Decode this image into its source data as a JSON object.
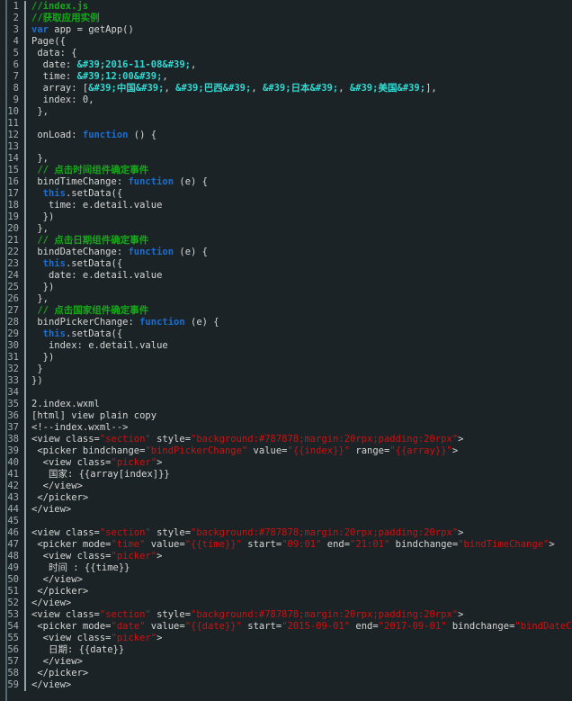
{
  "editor": {
    "background": "#1c2326",
    "gutter_color": "#9fb0b5",
    "default_text_color": "#d6d6d6",
    "comment_color": "#17a81a",
    "keyword_color": "#1a6fd4",
    "string_color": "#2fd9d2",
    "attribute_value_color": "#cc1111",
    "total_lines": 59
  },
  "lines": [
    {
      "n": "1",
      "tokens": [
        {
          "t": "comment",
          "s": "//index.js"
        }
      ]
    },
    {
      "n": "2",
      "tokens": [
        {
          "t": "comment",
          "s": "//获取应用实例"
        }
      ]
    },
    {
      "n": "3",
      "tokens": [
        {
          "t": "keyword",
          "s": "var"
        },
        {
          "t": "plain",
          "s": " app = getApp()"
        }
      ]
    },
    {
      "n": "4",
      "tokens": [
        {
          "t": "plain",
          "s": "Page({"
        }
      ]
    },
    {
      "n": "5",
      "tokens": [
        {
          "t": "plain",
          "s": " data: {"
        }
      ]
    },
    {
      "n": "6",
      "tokens": [
        {
          "t": "plain",
          "s": "  date: "
        },
        {
          "t": "string",
          "s": "&#39;2016-11-08&#39;"
        },
        {
          "t": "plain",
          "s": ","
        }
      ]
    },
    {
      "n": "7",
      "tokens": [
        {
          "t": "plain",
          "s": "  time: "
        },
        {
          "t": "string",
          "s": "&#39;12:00&#39;"
        },
        {
          "t": "plain",
          "s": ","
        }
      ]
    },
    {
      "n": "8",
      "tokens": [
        {
          "t": "plain",
          "s": "  array: ["
        },
        {
          "t": "string",
          "s": "&#39;中国&#39;"
        },
        {
          "t": "plain",
          "s": ", "
        },
        {
          "t": "string",
          "s": "&#39;巴西&#39;"
        },
        {
          "t": "plain",
          "s": ", "
        },
        {
          "t": "string",
          "s": "&#39;日本&#39;"
        },
        {
          "t": "plain",
          "s": ", "
        },
        {
          "t": "string",
          "s": "&#39;美国&#39;"
        },
        {
          "t": "plain",
          "s": "],"
        }
      ]
    },
    {
      "n": "9",
      "tokens": [
        {
          "t": "plain",
          "s": "  index: 0,"
        }
      ]
    },
    {
      "n": "10",
      "tokens": [
        {
          "t": "plain",
          "s": " },"
        }
      ]
    },
    {
      "n": "11",
      "tokens": []
    },
    {
      "n": "12",
      "tokens": [
        {
          "t": "plain",
          "s": " onLoad: "
        },
        {
          "t": "keyword",
          "s": "function"
        },
        {
          "t": "plain",
          "s": " () {"
        }
      ]
    },
    {
      "n": "13",
      "tokens": []
    },
    {
      "n": "14",
      "tokens": [
        {
          "t": "plain",
          "s": " },"
        }
      ]
    },
    {
      "n": "15",
      "tokens": [
        {
          "t": "plain",
          "s": " "
        },
        {
          "t": "comment",
          "s": "// 点击时间组件确定事件"
        }
      ]
    },
    {
      "n": "16",
      "tokens": [
        {
          "t": "plain",
          "s": " bindTimeChange: "
        },
        {
          "t": "keyword",
          "s": "function"
        },
        {
          "t": "plain",
          "s": " (e) {"
        }
      ]
    },
    {
      "n": "17",
      "tokens": [
        {
          "t": "plain",
          "s": "  "
        },
        {
          "t": "keyword",
          "s": "this"
        },
        {
          "t": "plain",
          "s": ".setData({"
        }
      ]
    },
    {
      "n": "18",
      "tokens": [
        {
          "t": "plain",
          "s": "   time: e.detail.value"
        }
      ]
    },
    {
      "n": "19",
      "tokens": [
        {
          "t": "plain",
          "s": "  })"
        }
      ]
    },
    {
      "n": "20",
      "tokens": [
        {
          "t": "plain",
          "s": " },"
        }
      ]
    },
    {
      "n": "21",
      "tokens": [
        {
          "t": "plain",
          "s": " "
        },
        {
          "t": "comment",
          "s": "// 点击日期组件确定事件"
        }
      ]
    },
    {
      "n": "22",
      "tokens": [
        {
          "t": "plain",
          "s": " bindDateChange: "
        },
        {
          "t": "keyword",
          "s": "function"
        },
        {
          "t": "plain",
          "s": " (e) {"
        }
      ]
    },
    {
      "n": "23",
      "tokens": [
        {
          "t": "plain",
          "s": "  "
        },
        {
          "t": "keyword",
          "s": "this"
        },
        {
          "t": "plain",
          "s": ".setData({"
        }
      ]
    },
    {
      "n": "24",
      "tokens": [
        {
          "t": "plain",
          "s": "   date: e.detail.value"
        }
      ]
    },
    {
      "n": "25",
      "tokens": [
        {
          "t": "plain",
          "s": "  })"
        }
      ]
    },
    {
      "n": "26",
      "tokens": [
        {
          "t": "plain",
          "s": " },"
        }
      ]
    },
    {
      "n": "27",
      "tokens": [
        {
          "t": "plain",
          "s": " "
        },
        {
          "t": "comment",
          "s": "// 点击国家组件确定事件"
        }
      ]
    },
    {
      "n": "28",
      "tokens": [
        {
          "t": "plain",
          "s": " bindPickerChange: "
        },
        {
          "t": "keyword",
          "s": "function"
        },
        {
          "t": "plain",
          "s": " (e) {"
        }
      ]
    },
    {
      "n": "29",
      "tokens": [
        {
          "t": "plain",
          "s": "  "
        },
        {
          "t": "keyword",
          "s": "this"
        },
        {
          "t": "plain",
          "s": ".setData({"
        }
      ]
    },
    {
      "n": "30",
      "tokens": [
        {
          "t": "plain",
          "s": "   index: e.detail.value"
        }
      ]
    },
    {
      "n": "31",
      "tokens": [
        {
          "t": "plain",
          "s": "  })"
        }
      ]
    },
    {
      "n": "32",
      "tokens": [
        {
          "t": "plain",
          "s": " }"
        }
      ]
    },
    {
      "n": "33",
      "tokens": [
        {
          "t": "plain",
          "s": "})"
        }
      ]
    },
    {
      "n": "34",
      "tokens": []
    },
    {
      "n": "35",
      "tokens": [
        {
          "t": "plain",
          "s": "2.index.wxml"
        }
      ]
    },
    {
      "n": "36",
      "tokens": [
        {
          "t": "plain",
          "s": "[html] view plain copy"
        }
      ]
    },
    {
      "n": "37",
      "tokens": [
        {
          "t": "plain",
          "s": "<!--index.wxml-->"
        }
      ]
    },
    {
      "n": "38",
      "tokens": [
        {
          "t": "tag",
          "s": "<view class="
        },
        {
          "t": "attrval",
          "s": "\"section\""
        },
        {
          "t": "tag",
          "s": " style="
        },
        {
          "t": "attrval",
          "s": "\"background:#787878;margin:20rpx;padding:20rpx\""
        },
        {
          "t": "tag",
          "s": ">"
        }
      ]
    },
    {
      "n": "39",
      "tokens": [
        {
          "t": "tag",
          "s": " <picker bindchange="
        },
        {
          "t": "attrval",
          "s": "\"bindPickerChange\""
        },
        {
          "t": "tag",
          "s": " value="
        },
        {
          "t": "attrval",
          "s": "\"{{index}}\""
        },
        {
          "t": "tag",
          "s": " range="
        },
        {
          "t": "attrval",
          "s": "\"{{array}}\""
        },
        {
          "t": "tag",
          "s": ">"
        }
      ]
    },
    {
      "n": "40",
      "tokens": [
        {
          "t": "tag",
          "s": "  <view class="
        },
        {
          "t": "attrval",
          "s": "\"picker\""
        },
        {
          "t": "tag",
          "s": ">"
        }
      ]
    },
    {
      "n": "41",
      "tokens": [
        {
          "t": "plain",
          "s": "   国家: {{array[index]}}"
        }
      ]
    },
    {
      "n": "42",
      "tokens": [
        {
          "t": "tag",
          "s": "  </view>"
        }
      ]
    },
    {
      "n": "43",
      "tokens": [
        {
          "t": "tag",
          "s": " </picker>"
        }
      ]
    },
    {
      "n": "44",
      "tokens": [
        {
          "t": "tag",
          "s": "</view>"
        }
      ]
    },
    {
      "n": "45",
      "tokens": []
    },
    {
      "n": "46",
      "tokens": [
        {
          "t": "tag",
          "s": "<view class="
        },
        {
          "t": "attrval",
          "s": "\"section\""
        },
        {
          "t": "tag",
          "s": " style="
        },
        {
          "t": "attrval",
          "s": "\"background:#787878;margin:20rpx;padding:20rpx\""
        },
        {
          "t": "tag",
          "s": ">"
        }
      ]
    },
    {
      "n": "47",
      "tokens": [
        {
          "t": "tag",
          "s": " <picker mode="
        },
        {
          "t": "attrval",
          "s": "\"time\""
        },
        {
          "t": "tag",
          "s": " value="
        },
        {
          "t": "attrval",
          "s": "\"{{time}}\""
        },
        {
          "t": "tag",
          "s": " start="
        },
        {
          "t": "attrval",
          "s": "\"09:01\""
        },
        {
          "t": "tag",
          "s": " end="
        },
        {
          "t": "attrval",
          "s": "\"21:01\""
        },
        {
          "t": "tag",
          "s": " bindchange="
        },
        {
          "t": "attrval",
          "s": "\"bindTimeChange\""
        },
        {
          "t": "tag",
          "s": ">"
        }
      ]
    },
    {
      "n": "48",
      "tokens": [
        {
          "t": "tag",
          "s": "  <view class="
        },
        {
          "t": "attrval",
          "s": "\"picker\""
        },
        {
          "t": "tag",
          "s": ">"
        }
      ]
    },
    {
      "n": "49",
      "tokens": [
        {
          "t": "plain",
          "s": "   时间 : {{time}}"
        }
      ]
    },
    {
      "n": "50",
      "tokens": [
        {
          "t": "tag",
          "s": "  </view>"
        }
      ]
    },
    {
      "n": "51",
      "tokens": [
        {
          "t": "tag",
          "s": " </picker>"
        }
      ]
    },
    {
      "n": "52",
      "tokens": [
        {
          "t": "tag",
          "s": "</view>"
        }
      ]
    },
    {
      "n": "53",
      "tokens": [
        {
          "t": "tag",
          "s": "<view class="
        },
        {
          "t": "attrval",
          "s": "\"section\""
        },
        {
          "t": "tag",
          "s": " style="
        },
        {
          "t": "attrval",
          "s": "\"background:#787878;margin:20rpx;padding:20rpx\""
        },
        {
          "t": "tag",
          "s": ">"
        }
      ]
    },
    {
      "n": "54",
      "tokens": [
        {
          "t": "tag",
          "s": " <picker mode="
        },
        {
          "t": "attrval",
          "s": "\"date\""
        },
        {
          "t": "tag",
          "s": " value="
        },
        {
          "t": "attrval",
          "s": "\"{{date}}\""
        },
        {
          "t": "tag",
          "s": " start="
        },
        {
          "t": "attrval",
          "s": "\"2015-09-01\""
        },
        {
          "t": "tag",
          "s": " end="
        },
        {
          "t": "attrval",
          "s": "\"2017-09-01\""
        },
        {
          "t": "tag",
          "s": " bindchange="
        },
        {
          "t": "attrval",
          "s": "\"bindDateChange\""
        },
        {
          "t": "tag",
          "s": ">"
        }
      ]
    },
    {
      "n": "55",
      "tokens": [
        {
          "t": "tag",
          "s": "  <view class="
        },
        {
          "t": "attrval",
          "s": "\"picker\""
        },
        {
          "t": "tag",
          "s": ">"
        }
      ]
    },
    {
      "n": "56",
      "tokens": [
        {
          "t": "plain",
          "s": "   日期: {{date}}"
        }
      ]
    },
    {
      "n": "57",
      "tokens": [
        {
          "t": "tag",
          "s": "  </view>"
        }
      ]
    },
    {
      "n": "58",
      "tokens": [
        {
          "t": "tag",
          "s": " </picker>"
        }
      ]
    },
    {
      "n": "59",
      "tokens": [
        {
          "t": "tag",
          "s": "</view>"
        }
      ]
    }
  ]
}
